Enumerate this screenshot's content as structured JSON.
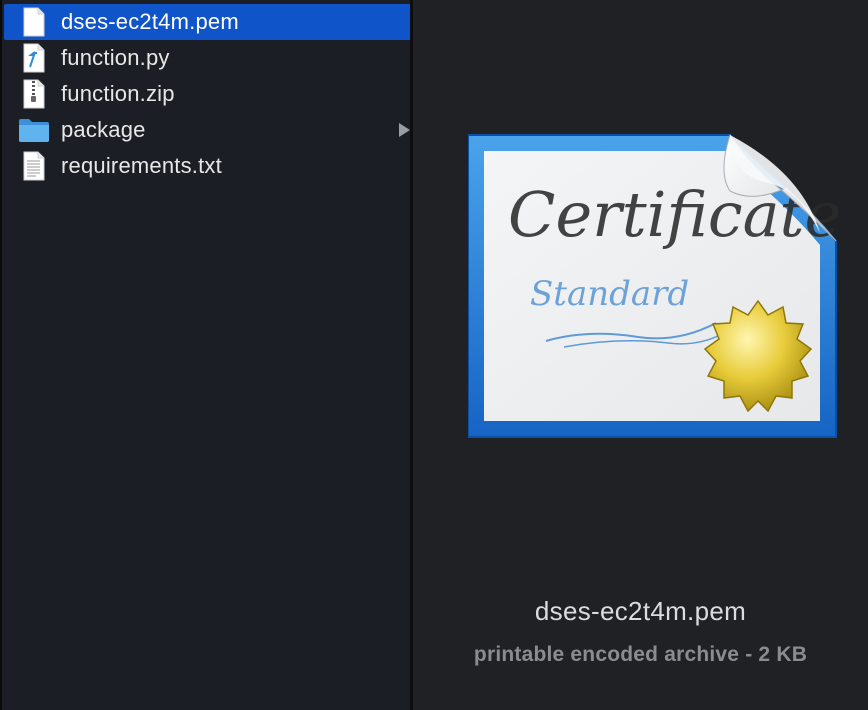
{
  "files": [
    {
      "name": "dses-ec2t4m.pem",
      "icon": "document-icon",
      "selected": true
    },
    {
      "name": "function.py",
      "icon": "python-file-icon",
      "selected": false
    },
    {
      "name": "function.zip",
      "icon": "zip-file-icon",
      "selected": false
    },
    {
      "name": "package",
      "icon": "folder-icon",
      "selected": false,
      "has_children": true
    },
    {
      "name": "requirements.txt",
      "icon": "text-file-icon",
      "selected": false
    }
  ],
  "preview": {
    "icon": "certificate-icon",
    "icon_text_main": "Certificate",
    "icon_text_sub": "Standard",
    "name": "dses-ec2t4m.pem",
    "meta": "printable encoded archive - 2 KB"
  },
  "colors": {
    "selection": "#0f55c9",
    "background": "#1b1e24",
    "text": "#e7e7e7"
  }
}
